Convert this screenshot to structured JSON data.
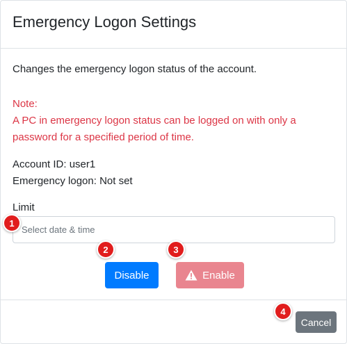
{
  "dialog": {
    "title": "Emergency Logon Settings",
    "description": "Changes the emergency logon status of the account.",
    "note_heading": "Note:",
    "note_line1": "A PC in emergency logon status can be logged on with only a",
    "note_line2": "password for a specified period of time.",
    "account_id_line": "Account ID: user1",
    "emergency_logon_line": "Emergency logon: Not set",
    "limit_label": "Limit",
    "limit_input": {
      "value": "",
      "placeholder": "Select date & time"
    },
    "buttons": {
      "disable_label": "Disable",
      "enable_label": "Enable",
      "enable_icon": "warning-triangle-icon",
      "cancel_label": "Cancel"
    }
  },
  "markers": [
    "1",
    "2",
    "3",
    "4"
  ],
  "colors": {
    "primary": "#007bff",
    "danger": "#dc3545",
    "secondary": "#6c757d",
    "marker": "#e11d1d"
  }
}
